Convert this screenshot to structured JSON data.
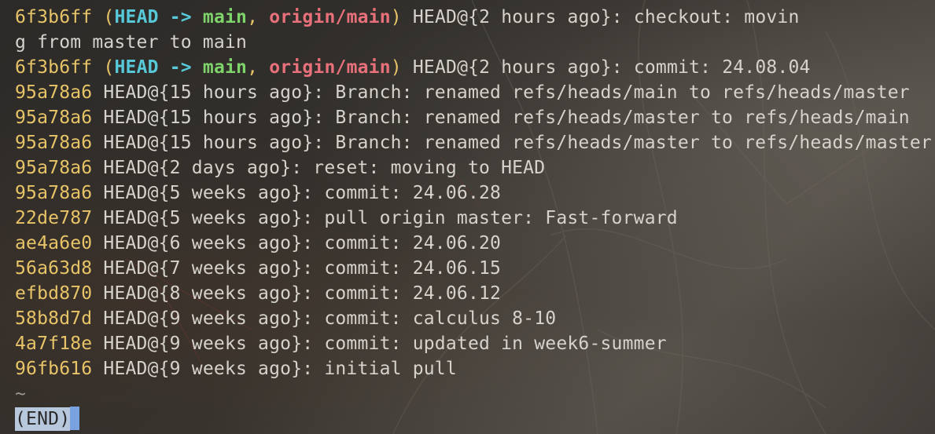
{
  "reflog": [
    {
      "hash": "6f3b6ff",
      "refs": {
        "head": "HEAD",
        "arrow": "->",
        "main": "main",
        "comma": ",",
        "origin": "origin/main"
      },
      "text": " HEAD@{2 hours ago}: checkout: movin"
    },
    {
      "wrap": "g from master to main"
    },
    {
      "hash": "6f3b6ff",
      "refs": {
        "head": "HEAD",
        "arrow": "->",
        "main": "main",
        "comma": ",",
        "origin": "origin/main"
      },
      "text": " HEAD@{2 hours ago}: commit: 24.08.04"
    },
    {
      "hash": "95a78a6",
      "text": " HEAD@{15 hours ago}: Branch: renamed refs/heads/main to refs/heads/master"
    },
    {
      "hash": "95a78a6",
      "text": " HEAD@{15 hours ago}: Branch: renamed refs/heads/master to refs/heads/main"
    },
    {
      "hash": "95a78a6",
      "text": " HEAD@{15 hours ago}: Branch: renamed refs/heads/master to refs/heads/master"
    },
    {
      "hash": "95a78a6",
      "text": " HEAD@{2 days ago}: reset: moving to HEAD"
    },
    {
      "hash": "95a78a6",
      "text": " HEAD@{5 weeks ago}: commit: 24.06.28"
    },
    {
      "hash": "22de787",
      "text": " HEAD@{5 weeks ago}: pull origin master: Fast-forward"
    },
    {
      "hash": "ae4a6e0",
      "text": " HEAD@{6 weeks ago}: commit: 24.06.20"
    },
    {
      "hash": "56a63d8",
      "text": " HEAD@{7 weeks ago}: commit: 24.06.15"
    },
    {
      "hash": "efbd870",
      "text": " HEAD@{8 weeks ago}: commit: 24.06.12"
    },
    {
      "hash": "58b8d7d",
      "text": " HEAD@{9 weeks ago}: commit: calculus 8-10"
    },
    {
      "hash": "4a7f18e",
      "text": " HEAD@{9 weeks ago}: commit: updated in week6-summer"
    },
    {
      "hash": "96fb616",
      "text": " HEAD@{9 weeks ago}: initial pull"
    }
  ],
  "pager": {
    "tilde": "~",
    "end_label": "(END)"
  },
  "colors": {
    "hash": "#e8c468",
    "head": "#56c8d8",
    "main": "#7ed36a",
    "origin": "#e8707a",
    "text": "#d6d2cc",
    "end_bg": "#b8c8dc",
    "cursor": "#7aa2e0"
  }
}
